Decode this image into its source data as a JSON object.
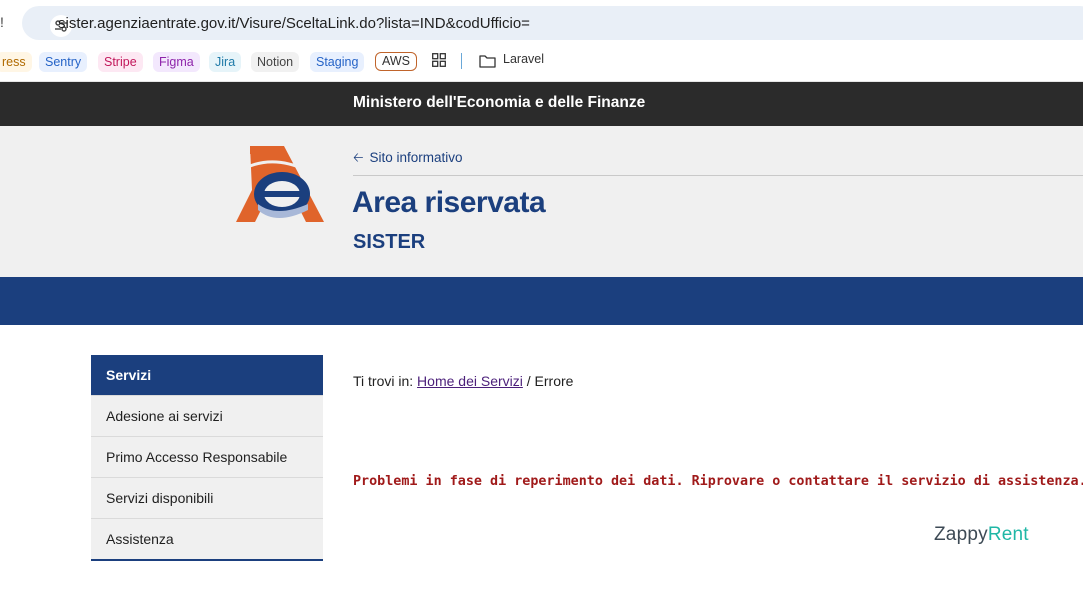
{
  "browser": {
    "left_glyph": "!",
    "url": "sister.agenziaentrate.gov.it/Visure/SceltaLink.do?lista=IND&codUfficio=",
    "bookmarks": [
      "ress",
      "Sentry",
      "Stripe",
      "Figma",
      "Jira",
      "Notion",
      "Staging",
      "AWS",
      "Laravel"
    ],
    "icons": {
      "settings": "site-settings-icon",
      "apps": "apps-grid-icon",
      "folder": "folder-icon"
    }
  },
  "header": {
    "ministry": "Ministero dell'Economia e delle Finanze",
    "back_link": "Sito informativo",
    "title": "Area riservata",
    "subtitle": "SISTER"
  },
  "sidebar": {
    "heading": "Servizi",
    "items": [
      {
        "label": "Adesione ai servizi"
      },
      {
        "label": "Primo Accesso Responsabile"
      },
      {
        "label": "Servizi disponibili"
      },
      {
        "label": "Assistenza"
      }
    ]
  },
  "main": {
    "breadcrumb_prefix": "Ti trovi in:",
    "breadcrumb_link": "Home dei Servizi",
    "breadcrumb_separator": "/",
    "breadcrumb_current": "Errore",
    "error_message": "Problemi in fase di reperimento dei dati. Riprovare o contattare il servizio di assistenza."
  },
  "watermark": {
    "part1": "Zappy",
    "part2": "Rent"
  },
  "colors": {
    "brand_blue": "#1b3f7e",
    "error_red": "#a01a1a",
    "logo_orange": "#e0642b"
  }
}
